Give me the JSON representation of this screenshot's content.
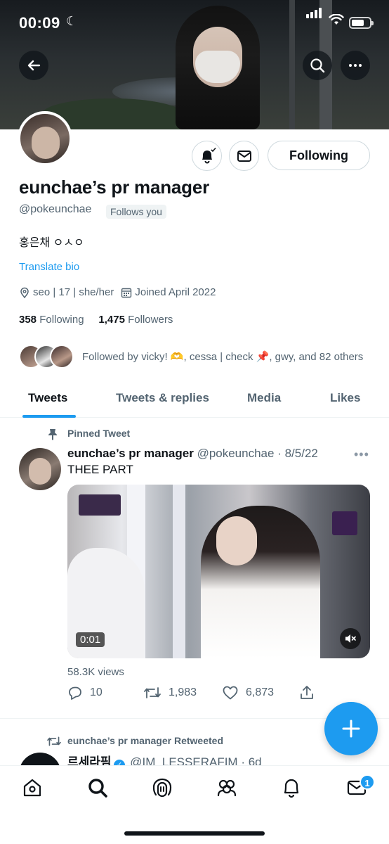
{
  "status_bar": {
    "time": "00:09",
    "battery_level": 0.7
  },
  "profile": {
    "display_name": "eunchae’s pr manager",
    "handle": "@pokeunchae",
    "follows_you_label": "Follows you",
    "bio": "홍은채 ㅇㅅㅇ",
    "translate_label": "Translate bio",
    "location": "seo | 17 | she/her",
    "joined": "Joined April 2022",
    "following_count": "358",
    "following_label": "Following",
    "followers_count": "1,475",
    "followers_label": "Followers",
    "followed_by": "Followed by vicky! 🫶, cessa | check 📌, gwy, and 82 others",
    "following_button": "Following"
  },
  "tabs": [
    {
      "label": "Tweets",
      "active": true
    },
    {
      "label": "Tweets & replies",
      "active": false
    },
    {
      "label": "Media",
      "active": false
    },
    {
      "label": "Likes",
      "active": false
    }
  ],
  "pinned_tweet": {
    "pinned_label": "Pinned Tweet",
    "author_name": "eunchae’s pr manager",
    "author_handle": "@pokeunchae",
    "date": "· 8/5/22",
    "more": "•••",
    "text": "THEE PART",
    "video_time": "0:01",
    "views": "58.3K views",
    "replies": "10",
    "retweets": "1,983",
    "likes": "6,873"
  },
  "retweet": {
    "label": "eunchae’s pr manager Retweeted",
    "author_name": "르세라핌",
    "author_handle": "@IM_LESSERAFIM",
    "date": "· 6d",
    "more": "•••"
  },
  "nav": {
    "items": [
      "home-icon",
      "search-icon",
      "spaces-icon",
      "communities-icon",
      "notifications-icon",
      "messages-icon"
    ],
    "messages_badge": "1"
  },
  "colors": {
    "accent": "#1d9bf0",
    "text": "#0f1419",
    "muted": "#536471"
  }
}
